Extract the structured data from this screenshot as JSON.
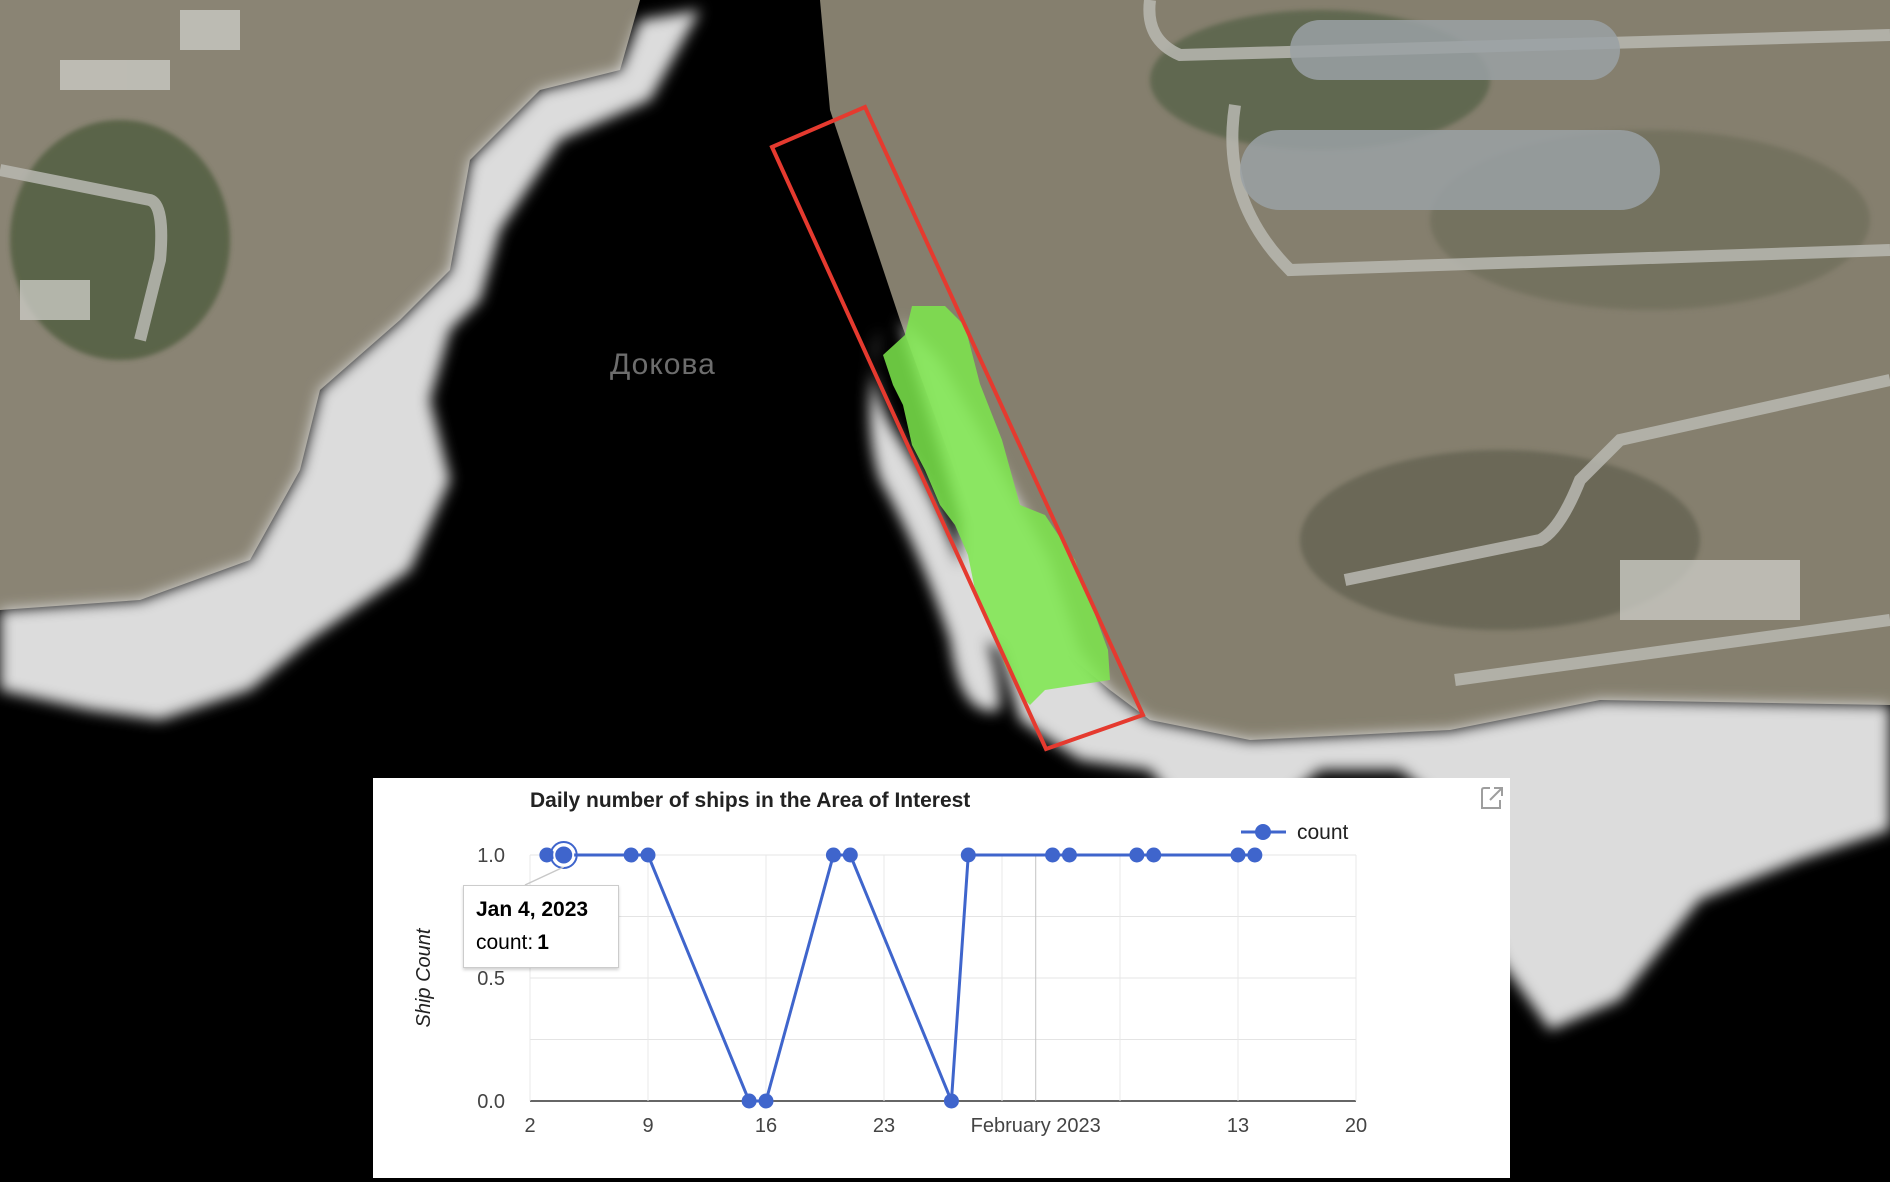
{
  "map": {
    "place_label": "Докова"
  },
  "chart_panel": {
    "expand_icon": "open-in-new-icon"
  },
  "chart_data": {
    "type": "line",
    "title": "Daily number of ships in the Area of Interest",
    "xlabel": "",
    "ylabel": "Ship Count",
    "x_axis_ticks": [
      "2",
      "9",
      "16",
      "23",
      "February 2023",
      "13",
      "20"
    ],
    "y_axis_ticks": [
      "0.0",
      "0.5",
      "1.0"
    ],
    "xlim": [
      "2023-01-02",
      "2023-02-20"
    ],
    "ylim": [
      0,
      1
    ],
    "grid": true,
    "legend_position": "top-right",
    "series": [
      {
        "name": "count",
        "color": "#3f65cc",
        "x": [
          "2023-01-03",
          "2023-01-04",
          "2023-01-08",
          "2023-01-09",
          "2023-01-15",
          "2023-01-16",
          "2023-01-20",
          "2023-01-21",
          "2023-01-27",
          "2023-01-28",
          "2023-02-02",
          "2023-02-03",
          "2023-02-07",
          "2023-02-08",
          "2023-02-13",
          "2023-02-14"
        ],
        "values": [
          1,
          1,
          1,
          1,
          0,
          0,
          1,
          1,
          0,
          1,
          1,
          1,
          1,
          1,
          1,
          1
        ]
      }
    ],
    "tooltip": {
      "date": "Jan 4, 2023",
      "series_label": "count:",
      "value": "1"
    }
  },
  "colors": {
    "aoi_outline": "#e53a2f",
    "ship_mask": "#7de84c",
    "series": "#3f65cc",
    "water": "#000000",
    "land_mask": "#d9d9d9"
  }
}
